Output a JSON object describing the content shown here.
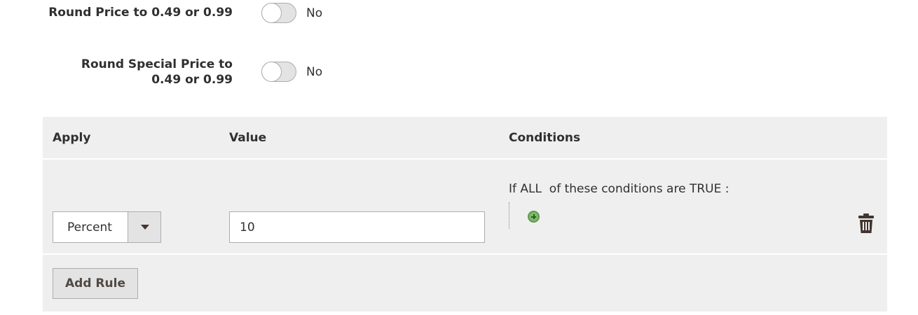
{
  "round_price": {
    "label": "Round Price to 0.49 or 0.99",
    "state": "No"
  },
  "round_special_price": {
    "label": "Round Special Price to 0.49 or 0.99",
    "state": "No"
  },
  "rules_grid": {
    "headers": {
      "apply": "Apply",
      "value": "Value",
      "conditions": "Conditions"
    },
    "rows": [
      {
        "apply": "Percent",
        "value": "10",
        "conditions": {
          "prefix": "If ",
          "aggregator": "ALL",
          "middle": "  of these conditions are ",
          "result": "TRUE",
          "suffix": " :"
        }
      }
    ],
    "add_rule_label": "Add Rule"
  },
  "icons": {
    "add_condition": "plus-circle-icon",
    "delete": "trash-icon",
    "dropdown": "chevron-down-icon"
  },
  "colors": {
    "grid_bg": "#efefef",
    "button_bg": "#e3e3e3",
    "text": "#303030",
    "add_icon": "#7fb86a"
  }
}
